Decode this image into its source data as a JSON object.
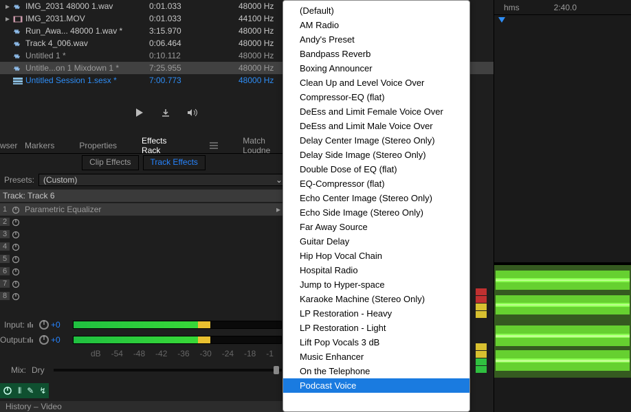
{
  "files": [
    {
      "twist": true,
      "type": "audio",
      "name": "IMG_2031 48000 1.wav",
      "dur": "0:01.033",
      "sr": "48000 Hz"
    },
    {
      "twist": true,
      "type": "video",
      "name": "IMG_2031.MOV",
      "dur": "0:01.033",
      "sr": "44100 Hz"
    },
    {
      "twist": false,
      "type": "audio",
      "name": "Run_Awa... 48000 1.wav *",
      "dur": "3:15.970",
      "sr": "48000 Hz"
    },
    {
      "twist": false,
      "type": "audio",
      "name": "Track 4_006.wav",
      "dur": "0:06.464",
      "sr": "48000 Hz"
    },
    {
      "twist": false,
      "type": "audio",
      "name": "Untitled 1 *",
      "dur": "0:10.112",
      "sr": "48000 Hz",
      "dim": true
    },
    {
      "twist": false,
      "type": "audio",
      "name": "Untitle...on 1 Mixdown 1 *",
      "dur": "7:25.955",
      "sr": "48000 Hz",
      "dim": true,
      "sel": true
    },
    {
      "twist": false,
      "type": "session",
      "name": "Untitled Session 1.sesx *",
      "dur": "7:00.773",
      "sr": "48000 Hz",
      "lastsel": true
    }
  ],
  "tabs": {
    "browser": "wser",
    "markers": "Markers",
    "properties": "Properties",
    "effects": "Effects Rack",
    "loudness": "Match Loudne"
  },
  "subtabs": {
    "clip": "Clip Effects",
    "track": "Track Effects"
  },
  "presets": {
    "label": "Presets:",
    "value": "(Custom)"
  },
  "track": {
    "label": "Track: Track 6"
  },
  "slots": [
    {
      "n": "1",
      "fx": "Parametric Equalizer",
      "has": true
    },
    {
      "n": "2"
    },
    {
      "n": "3"
    },
    {
      "n": "4"
    },
    {
      "n": "5"
    },
    {
      "n": "6"
    },
    {
      "n": "7"
    },
    {
      "n": "8"
    }
  ],
  "io": {
    "input": "Input:",
    "output": "Output:",
    "gain": "+0"
  },
  "ruler": [
    "dB",
    "-54",
    "-48",
    "-42",
    "-36",
    "-30",
    "-24",
    "-18",
    "-1"
  ],
  "mix": {
    "label": "Mix:",
    "dry": "Dry"
  },
  "footer": {
    "history": "History",
    "video": "Video"
  },
  "timeline": {
    "col1": "hms",
    "col2": "2:40.0"
  },
  "menu": {
    "items": [
      "(Default)",
      "AM Radio",
      "Andy's Preset",
      "Bandpass Reverb",
      "Boxing Announcer",
      "Clean Up and Level Voice Over",
      "Compressor-EQ (flat)",
      "DeEss and Limit Female Voice Over",
      "DeEss and Limit Male Voice Over",
      "Delay Center Image (Stereo Only)",
      "Delay Side Image (Stereo Only)",
      "Double Dose of EQ (flat)",
      "EQ-Compressor (flat)",
      "Echo Center Image (Stereo Only)",
      "Echo Side Image (Stereo Only)",
      "Far Away Source",
      "Guitar Delay",
      "Hip Hop Vocal Chain",
      "Hospital Radio",
      "Jump to Hyper-space",
      "Karaoke Machine (Stereo Only)",
      "LP Restoration - Heavy",
      "LP Restoration - Light",
      "Lift Pop Vocals 3 dB",
      "Music Enhancer",
      "On the Telephone",
      "Podcast Voice"
    ],
    "selected": 26
  }
}
